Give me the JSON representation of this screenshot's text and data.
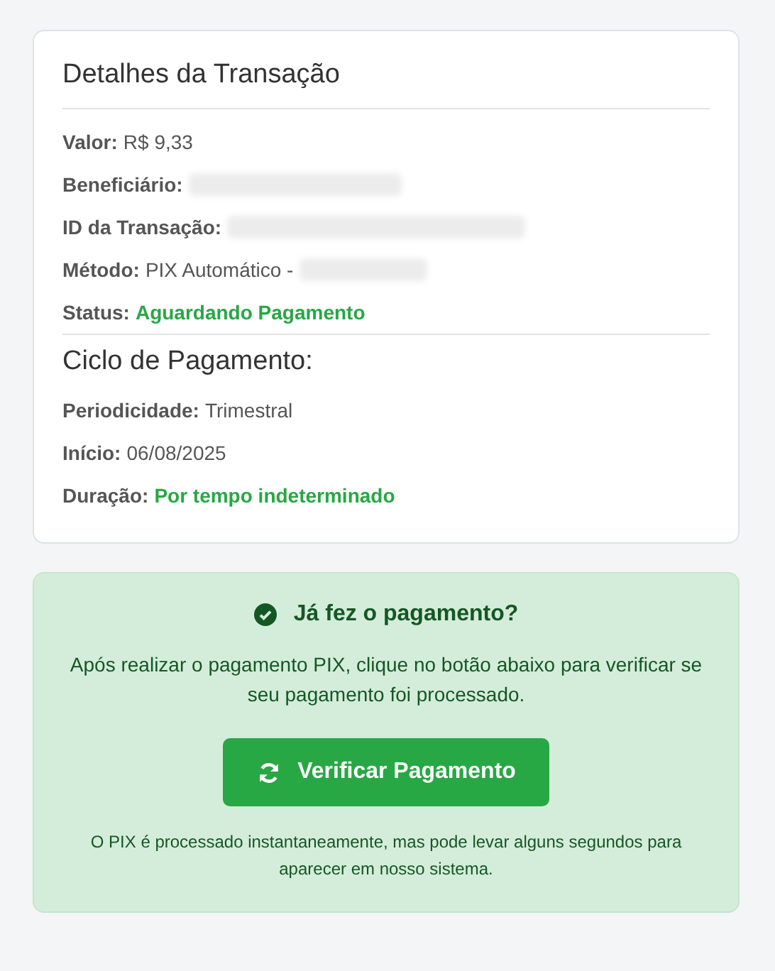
{
  "details": {
    "title": "Detalhes da Transação",
    "fields": [
      {
        "label": "Valor:",
        "value": "R$ 9,33",
        "kind": "text",
        "redacted": false
      },
      {
        "label": "Beneficiário:",
        "redacted": true
      },
      {
        "label": "ID da Transação:",
        "redacted": true
      },
      {
        "label": "Método:",
        "value": "PIX Automático -",
        "kind": "text",
        "redacted": true
      },
      {
        "label": "Status:",
        "value": "Aguardando Pagamento",
        "kind": "highlight",
        "redacted": false
      }
    ]
  },
  "cycle": {
    "title": "Ciclo de Pagamento:",
    "fields": [
      {
        "label": "Periodicidade:",
        "value": "Trimestral",
        "kind": "text"
      },
      {
        "label": "Início:",
        "value": "06/08/2025",
        "kind": "text"
      },
      {
        "label": "Duração:",
        "value": "Por tempo indeterminado",
        "kind": "highlight"
      }
    ]
  },
  "confirm": {
    "title": "Já fez o pagamento?",
    "text": "Após realizar o pagamento PIX, clique no botão abaixo para verificar se seu pagamento foi processado.",
    "button": "Verificar Pagamento",
    "note": "O PIX é processado instantaneamente, mas pode levar alguns segundos para aparecer em nosso sistema."
  }
}
